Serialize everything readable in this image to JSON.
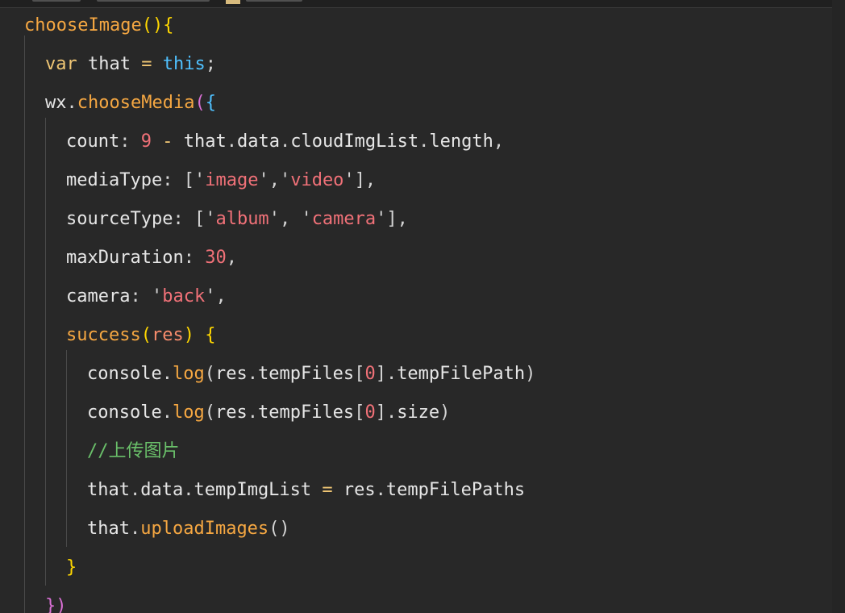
{
  "editor": {
    "background": "#282828",
    "lines": [
      {
        "tokens": [
          {
            "t": "chooseImage",
            "c": "fn"
          },
          {
            "t": "()",
            "c": "br"
          },
          {
            "t": "{",
            "c": "br"
          }
        ]
      },
      {
        "tokens": [
          {
            "t": "var",
            "c": "kw"
          },
          {
            "t": " that ",
            "c": "prop"
          },
          {
            "t": "=",
            "c": "op"
          },
          {
            "t": " ",
            "c": "pn"
          },
          {
            "t": "this",
            "c": "this"
          },
          {
            "t": ";",
            "c": "pn"
          }
        ]
      },
      {
        "tokens": [
          {
            "t": "wx",
            "c": "prop"
          },
          {
            "t": ".",
            "c": "pn"
          },
          {
            "t": "chooseMedia",
            "c": "fn"
          },
          {
            "t": "(",
            "c": "br2"
          },
          {
            "t": "{",
            "c": "br3"
          }
        ]
      },
      {
        "tokens": [
          {
            "t": "count",
            "c": "prop"
          },
          {
            "t": ": ",
            "c": "pn"
          },
          {
            "t": "9",
            "c": "num"
          },
          {
            "t": " ",
            "c": "pn"
          },
          {
            "t": "-",
            "c": "op"
          },
          {
            "t": " that",
            "c": "prop"
          },
          {
            "t": ".",
            "c": "pn"
          },
          {
            "t": "data",
            "c": "prop"
          },
          {
            "t": ".",
            "c": "pn"
          },
          {
            "t": "cloudImgList",
            "c": "prop"
          },
          {
            "t": ".",
            "c": "pn"
          },
          {
            "t": "length",
            "c": "prop"
          },
          {
            "t": ",",
            "c": "pn"
          }
        ]
      },
      {
        "tokens": [
          {
            "t": "mediaType",
            "c": "prop"
          },
          {
            "t": ": ",
            "c": "pn"
          },
          {
            "t": "[",
            "c": "pn"
          },
          {
            "t": "'",
            "c": "pn"
          },
          {
            "t": "image",
            "c": "str"
          },
          {
            "t": "'",
            "c": "pn"
          },
          {
            "t": ",",
            "c": "pn"
          },
          {
            "t": "'",
            "c": "pn"
          },
          {
            "t": "video",
            "c": "str"
          },
          {
            "t": "'",
            "c": "pn"
          },
          {
            "t": "],",
            "c": "pn"
          }
        ]
      },
      {
        "tokens": [
          {
            "t": "sourceType",
            "c": "prop"
          },
          {
            "t": ": ",
            "c": "pn"
          },
          {
            "t": "[",
            "c": "pn"
          },
          {
            "t": "'",
            "c": "pn"
          },
          {
            "t": "album",
            "c": "str"
          },
          {
            "t": "'",
            "c": "pn"
          },
          {
            "t": ", ",
            "c": "pn"
          },
          {
            "t": "'",
            "c": "pn"
          },
          {
            "t": "camera",
            "c": "str"
          },
          {
            "t": "'",
            "c": "pn"
          },
          {
            "t": "],",
            "c": "pn"
          }
        ]
      },
      {
        "tokens": [
          {
            "t": "maxDuration",
            "c": "prop"
          },
          {
            "t": ": ",
            "c": "pn"
          },
          {
            "t": "30",
            "c": "num"
          },
          {
            "t": ",",
            "c": "pn"
          }
        ]
      },
      {
        "tokens": [
          {
            "t": "camera",
            "c": "prop"
          },
          {
            "t": ": ",
            "c": "pn"
          },
          {
            "t": "'",
            "c": "pn"
          },
          {
            "t": "back",
            "c": "str"
          },
          {
            "t": "'",
            "c": "pn"
          },
          {
            "t": ",",
            "c": "pn"
          }
        ]
      },
      {
        "tokens": [
          {
            "t": "success",
            "c": "fn"
          },
          {
            "t": "(",
            "c": "br"
          },
          {
            "t": "res",
            "c": "param"
          },
          {
            "t": ")",
            "c": "br"
          },
          {
            "t": " ",
            "c": "pn"
          },
          {
            "t": "{",
            "c": "br"
          }
        ]
      },
      {
        "tokens": [
          {
            "t": "console",
            "c": "prop"
          },
          {
            "t": ".",
            "c": "pn"
          },
          {
            "t": "log",
            "c": "fn"
          },
          {
            "t": "(",
            "c": "pn"
          },
          {
            "t": "res",
            "c": "prop"
          },
          {
            "t": ".",
            "c": "pn"
          },
          {
            "t": "tempFiles",
            "c": "prop"
          },
          {
            "t": "[",
            "c": "pn"
          },
          {
            "t": "0",
            "c": "num"
          },
          {
            "t": "]",
            "c": "pn"
          },
          {
            "t": ".",
            "c": "pn"
          },
          {
            "t": "tempFilePath",
            "c": "prop"
          },
          {
            "t": ")",
            "c": "pn"
          }
        ]
      },
      {
        "tokens": [
          {
            "t": "console",
            "c": "prop"
          },
          {
            "t": ".",
            "c": "pn"
          },
          {
            "t": "log",
            "c": "fn"
          },
          {
            "t": "(",
            "c": "pn"
          },
          {
            "t": "res",
            "c": "prop"
          },
          {
            "t": ".",
            "c": "pn"
          },
          {
            "t": "tempFiles",
            "c": "prop"
          },
          {
            "t": "[",
            "c": "pn"
          },
          {
            "t": "0",
            "c": "num"
          },
          {
            "t": "]",
            "c": "pn"
          },
          {
            "t": ".",
            "c": "pn"
          },
          {
            "t": "size",
            "c": "prop"
          },
          {
            "t": ")",
            "c": "pn"
          }
        ]
      },
      {
        "tokens": [
          {
            "t": "//上传图片",
            "c": "cm"
          }
        ]
      },
      {
        "tokens": [
          {
            "t": "that",
            "c": "prop"
          },
          {
            "t": ".",
            "c": "pn"
          },
          {
            "t": "data",
            "c": "prop"
          },
          {
            "t": ".",
            "c": "pn"
          },
          {
            "t": "tempImgList",
            "c": "prop"
          },
          {
            "t": " ",
            "c": "pn"
          },
          {
            "t": "=",
            "c": "op"
          },
          {
            "t": " res",
            "c": "prop"
          },
          {
            "t": ".",
            "c": "pn"
          },
          {
            "t": "tempFilePaths",
            "c": "prop"
          }
        ]
      },
      {
        "tokens": [
          {
            "t": "that",
            "c": "prop"
          },
          {
            "t": ".",
            "c": "pn"
          },
          {
            "t": "uploadImages",
            "c": "fn"
          },
          {
            "t": "()",
            "c": "pn"
          }
        ]
      },
      {
        "tokens": [
          {
            "t": "}",
            "c": "br"
          }
        ]
      },
      {
        "tokens": [
          {
            "t": "})",
            "c": "br2"
          }
        ]
      }
    ]
  }
}
